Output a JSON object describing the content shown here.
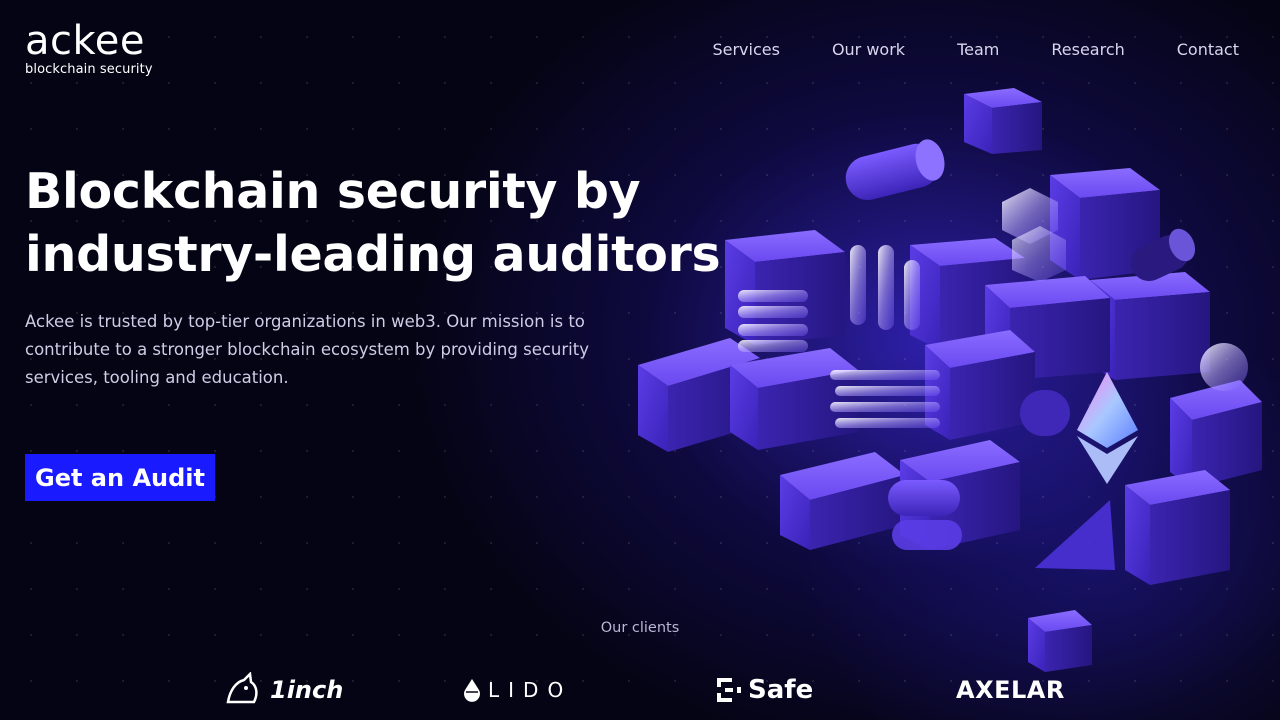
{
  "logo": {
    "word": "ackee",
    "tagline": "blockchain security"
  },
  "nav": {
    "items": [
      {
        "label": "Services"
      },
      {
        "label": "Our work"
      },
      {
        "label": "Team"
      },
      {
        "label": "Research"
      },
      {
        "label": "Contact"
      }
    ]
  },
  "hero": {
    "title_line1": "Blockchain security by",
    "title_line2": "industry-leading auditors",
    "subtitle": "Ackee is trusted by top-tier organizations in web3. Our mission is to contribute to a stronger blockchain ecosystem by providing security services, tooling and education.",
    "cta_label": "Get an Audit"
  },
  "clients": {
    "label": "Our clients",
    "logos": [
      {
        "name": "1inch",
        "icon": "unicorn-icon"
      },
      {
        "name": "LIDO",
        "icon": "drop-icon"
      },
      {
        "name": "Safe",
        "icon": "safe-icon"
      },
      {
        "name": "AXELAR",
        "icon": ""
      }
    ]
  },
  "colors": {
    "background": "#050414",
    "accent": "#1a1aff",
    "glow": "#3c28dc",
    "cube": "#5a3be0"
  }
}
